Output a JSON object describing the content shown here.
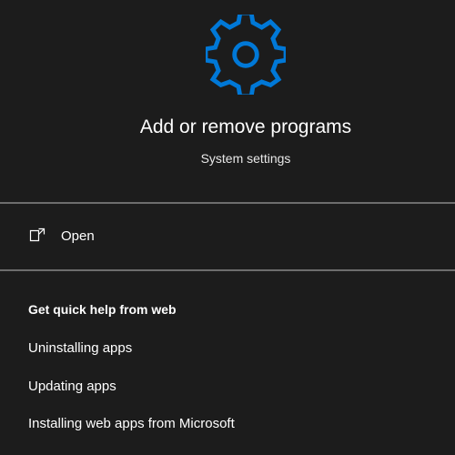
{
  "app": {
    "title": "Add or remove programs",
    "subtitle": "System settings",
    "icon": "gear-icon",
    "accent_color": "#0078d7"
  },
  "actions": {
    "open_label": "Open",
    "open_icon": "open-external-icon"
  },
  "help": {
    "heading": "Get quick help from web",
    "links": [
      "Uninstalling apps",
      "Updating apps",
      "Installing web apps from Microsoft"
    ]
  },
  "colors": {
    "background": "#1c1c1c",
    "text": "#ffffff",
    "divider": "#6d6d6d"
  }
}
